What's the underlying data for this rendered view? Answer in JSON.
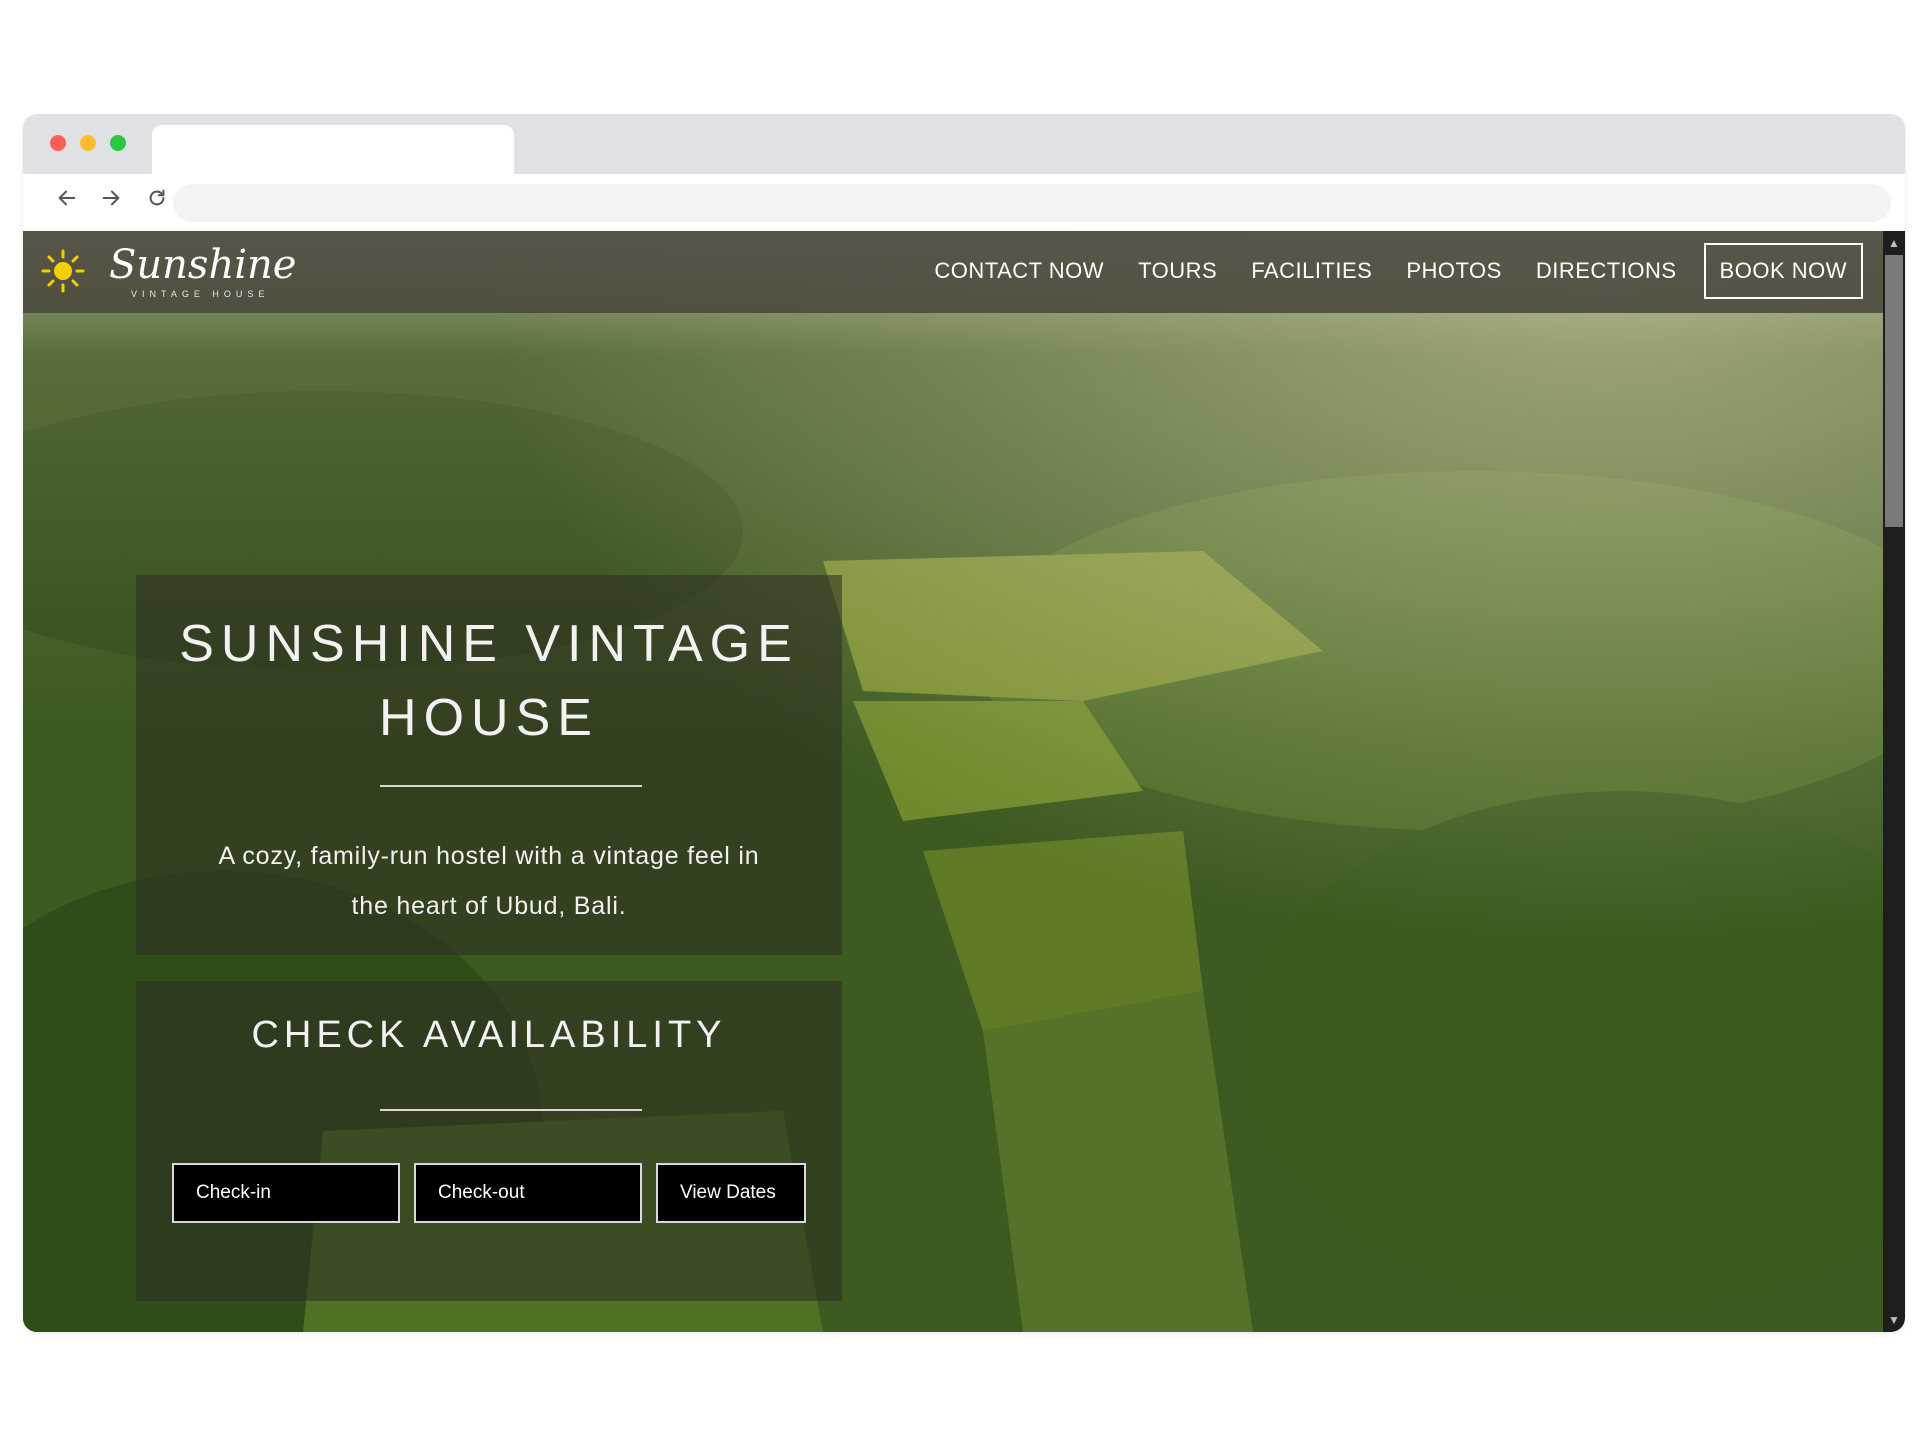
{
  "browser": {
    "tab_title": "",
    "address": ""
  },
  "site": {
    "logo_text": "Sunshine",
    "logo_subtext": "VINTAGE HOUSE",
    "nav": [
      {
        "label": "CONTACT NOW"
      },
      {
        "label": "TOURS"
      },
      {
        "label": "FACILITIES"
      },
      {
        "label": "PHOTOS"
      },
      {
        "label": "DIRECTIONS"
      }
    ],
    "book_label": "BOOK NOW"
  },
  "intro": {
    "title_line1": "SUNSHINE VINTAGE",
    "title_line2": "HOUSE",
    "text_line1": "A cozy, family-run hostel with a vintage feel in",
    "text_line2": "the heart of Ubud, Bali."
  },
  "availability": {
    "title": "CHECK AVAILABILITY",
    "checkin_label": "Check-in",
    "checkout_label": "Check-out",
    "view_label": "View Dates"
  },
  "colors": {
    "header_bg": "#4a483c",
    "sun": "#f5d000",
    "foliage": "#3f5a22"
  }
}
